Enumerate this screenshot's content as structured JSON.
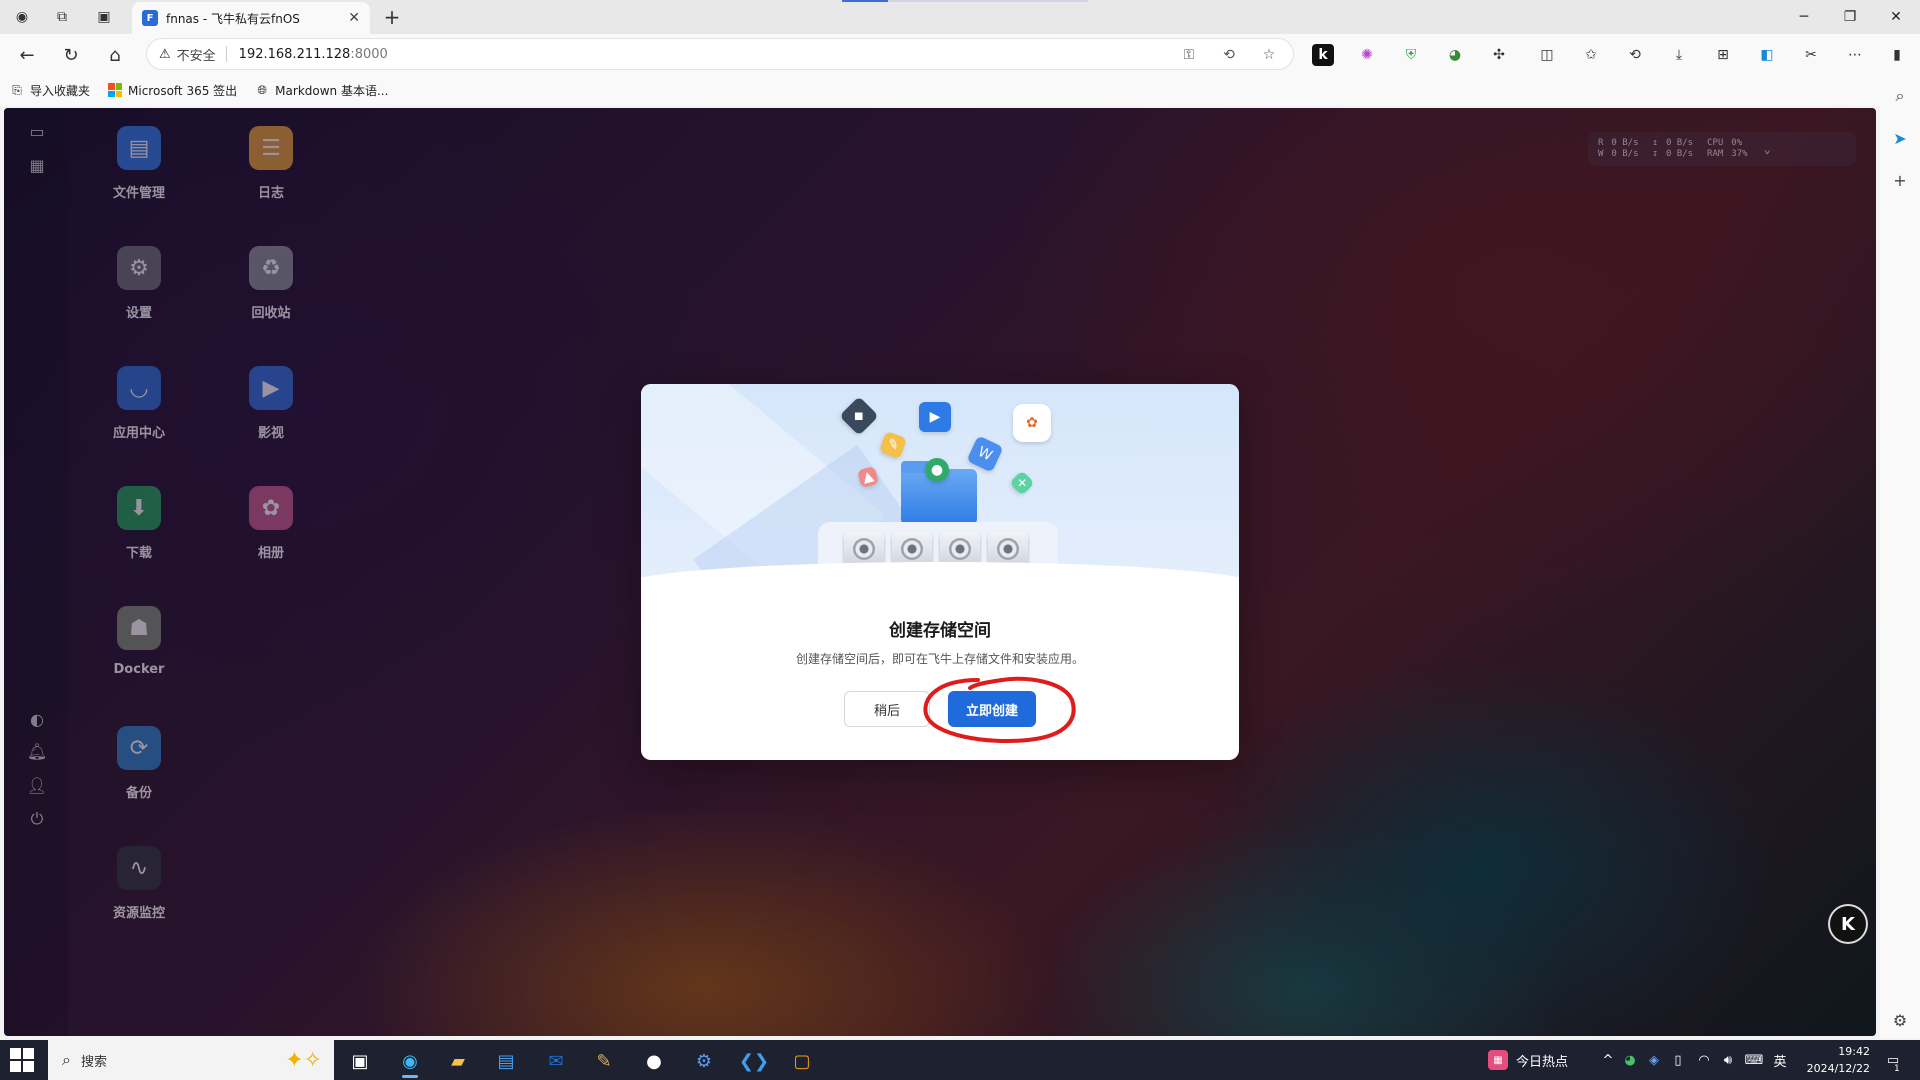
{
  "browser": {
    "tab_title": "fnnas - 飞牛私有云fnOS",
    "tab_favicon": "F",
    "address": {
      "security_label": "不安全",
      "host": "192.168.211.128",
      "port": ":8000"
    },
    "bookmarks": [
      {
        "label": "导入收藏夹"
      },
      {
        "label": "Microsoft 365 签出"
      },
      {
        "label": "Markdown 基本语..."
      }
    ]
  },
  "desktop": {
    "apps": [
      {
        "label": "文件管理",
        "color": "#2f7be6",
        "glyph": "▤"
      },
      {
        "label": "日志",
        "color": "#e8a23a",
        "glyph": "☰"
      },
      {
        "label": "设置",
        "color": "#6b6f78",
        "glyph": "⚙"
      },
      {
        "label": "回收站",
        "color": "#8a8f99",
        "glyph": "♻"
      },
      {
        "label": "应用中心",
        "color": "#2a6fd6",
        "glyph": "◡"
      },
      {
        "label": "影视",
        "color": "#2f6fd8",
        "glyph": "▶"
      },
      {
        "label": "下载",
        "color": "#22a05a",
        "glyph": "⬇"
      },
      {
        "label": "相册",
        "color": "#c65a8c",
        "glyph": "✿"
      },
      {
        "label": "Docker",
        "color": "#7f8a7a",
        "glyph": "☗"
      },
      {
        "label": "备份",
        "color": "#2a80c8",
        "glyph": "⟳"
      },
      {
        "label": "资源监控",
        "color": "#2a3340",
        "glyph": "∿"
      }
    ],
    "monitor": {
      "r_label": "R",
      "w_label": "W",
      "r_rate": "0 B/s",
      "w_rate": "0 B/s",
      "up_rate": "0 B/s",
      "down_rate": "0 B/s",
      "cpu_label": "CPU",
      "ram_label": "RAM",
      "cpu_value": "0%",
      "ram_value": "37%"
    },
    "badge": "K"
  },
  "dialog": {
    "title": "创建存储空间",
    "description": "创建存储空间后，即可在飞牛上存储文件和安装应用。",
    "later_button": "稍后",
    "create_button": "立即创建"
  },
  "taskbar": {
    "search_placeholder": "搜索",
    "hot_label": "今日热点",
    "ime_label": "英",
    "time": "19:42",
    "date": "2024/12/22",
    "notification_count": "1"
  }
}
